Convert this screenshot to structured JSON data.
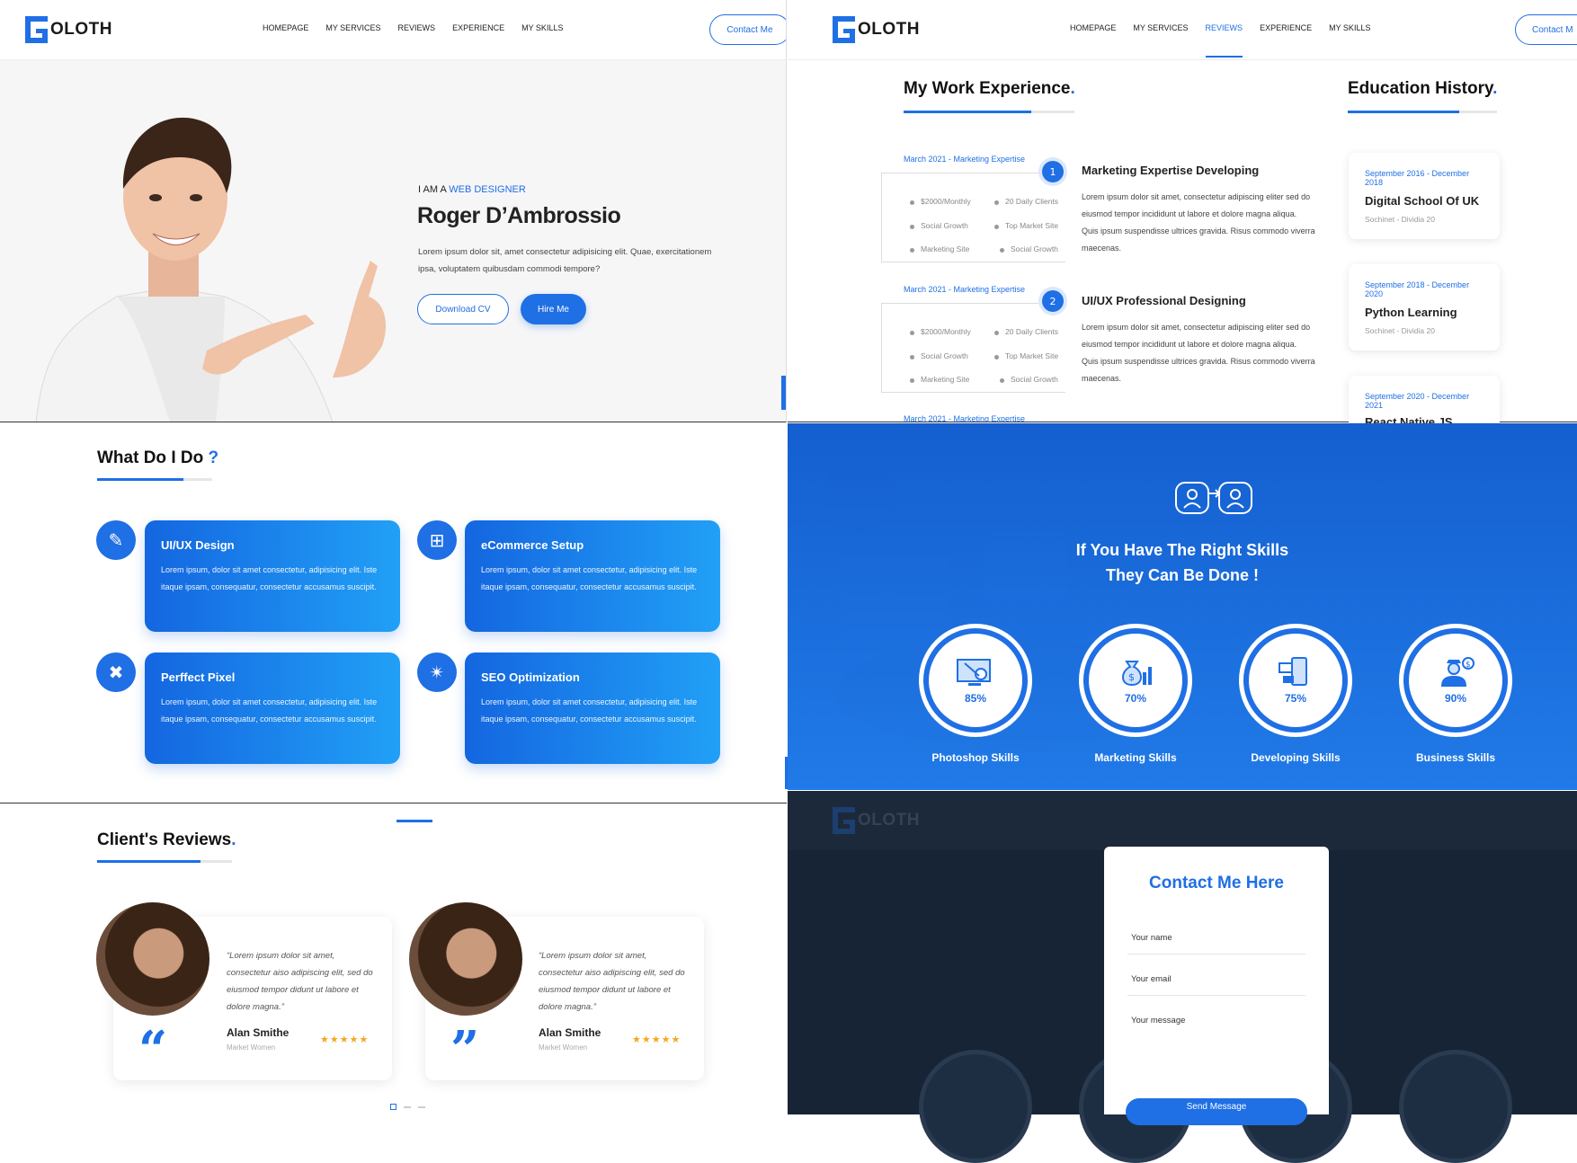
{
  "brand": {
    "logo_letters": "OLOTH",
    "accent": "#1f6fe5"
  },
  "nav": [
    "HOMEPAGE",
    "MY SERVICES",
    "REVIEWS",
    "EXPERIENCE",
    "MY SKILLS"
  ],
  "nav_active_index_panel2": 2,
  "contact_button": "Contact Me",
  "contact_button_cropped": "Contact M",
  "hero": {
    "kicker_prefix": "I AM A ",
    "kicker_highlight": "WEB DESIGNER",
    "name": "Roger D’Ambrossio",
    "text": "Lorem ipsum dolor sit, amet consectetur adipisicing elit. Quae, exercitationem ipsa, voluptatem quibusdam commodi tempore?",
    "download_label": "Download CV",
    "hire_label": "Hire Me"
  },
  "experience": {
    "title": "My Work Experience",
    "items": [
      {
        "date": "March 2021 - Marketing Expertise",
        "num": "1",
        "title": "Marketing Expertise Developing",
        "desc": "Lorem ipsum dolor sit amet, consectetur adipiscing eliter sed do eiusmod tempor incididunt ut labore et dolore magna aliqua. Quis ipsum suspendisse ultrices gravida. Risus commodo viverra maecenas.",
        "bullets": [
          "$2000/Monthly",
          "20 Daily Clients",
          "Social Growth",
          "Top Market Site",
          "Marketing Site",
          "Social Growth"
        ]
      },
      {
        "date": "March 2021 - Marketing Expertise",
        "num": "2",
        "title": "UI/UX Professional Designing",
        "desc": "Lorem ipsum dolor sit amet, consectetur adipiscing eliter sed do eiusmod tempor incididunt ut labore et dolore magna aliqua. Quis ipsum suspendisse ultrices gravida. Risus commodo viverra maecenas.",
        "bullets": [
          "$2000/Monthly",
          "20 Daily Clients",
          "Social Growth",
          "Top Market Site",
          "Marketing Site",
          "Social Growth"
        ]
      },
      {
        "date": "March 2021 - Marketing Expertise"
      }
    ]
  },
  "education": {
    "title": "Education History",
    "items": [
      {
        "date": "September 2016 - December 2018",
        "school": "Digital School Of UK",
        "loc": "Sochinet - Dividia 20"
      },
      {
        "date": "September 2018 - December 2020",
        "school": "Python Learning",
        "loc": "Sochinet - Dividia 20"
      },
      {
        "date": "September 2020 - December 2021",
        "school": "React Native JS Courses"
      }
    ]
  },
  "services": {
    "title": "What Do I Do",
    "title_mark": "?",
    "items": [
      {
        "title": "UI/UX Design",
        "text": "Lorem ipsum, dolor sit amet consectetur, adipisicing elit. Iste itaque ipsam, consequatur, consectetur accusamus suscipit.",
        "icon": "pencil-icon",
        "glyph": "✎"
      },
      {
        "title": "eCommerce Setup",
        "text": "Lorem ipsum, dolor sit amet consectetur, adipisicing elit. Iste itaque ipsam, consequatur, consectetur accusamus suscipit.",
        "icon": "cart-icon",
        "glyph": "⊞"
      },
      {
        "title": "Perffect Pixel",
        "text": "Lorem ipsum, dolor sit amet consectetur, adipisicing elit. Iste itaque ipsam, consequatur, consectetur accusamus suscipit.",
        "icon": "tools-icon",
        "glyph": "✖"
      },
      {
        "title": "SEO Optimization",
        "text": "Lorem ipsum, dolor sit amet consectetur, adipisicing elit. Iste itaque ipsam, consequatur, consectetur accusamus suscipit.",
        "icon": "rocket-icon",
        "glyph": "✴"
      }
    ]
  },
  "skills": {
    "headline_1": "If You Have The Right Skills",
    "headline_2": "They Can Be Done !",
    "items": [
      {
        "label": "Photoshop Skills",
        "pct": "85%",
        "icon": "design-monitor-icon"
      },
      {
        "label": "Marketing Skills",
        "pct": "70%",
        "icon": "money-bag-icon"
      },
      {
        "label": "Developing Skills",
        "pct": "75%",
        "icon": "devices-icon"
      },
      {
        "label": "Business Skills",
        "pct": "90%",
        "icon": "businessman-icon"
      }
    ]
  },
  "reviews": {
    "title": "Client's Reviews",
    "items": [
      {
        "quote": "“Lorem ipsum dolor sit amet, consectetur aiso adipiscing elit, sed do eiusmod tempor didunt ut labore et dolore magna.”",
        "name": "Alan Smithe",
        "role": "Market Women",
        "stars": "★★★★★",
        "qmark": "“"
      },
      {
        "quote": "“Lorem ipsum dolor sit amet, consectetur aiso adipiscing elit, sed do eiusmod tempor didunt ut labore et dolore magna.”",
        "name": "Alan Smithe",
        "role": "Market Women",
        "stars": "★★★★★",
        "qmark": "”"
      }
    ]
  },
  "contact": {
    "title": "Contact Me Here",
    "name_ph": "Your name",
    "email_ph": "Your email",
    "message_ph": "Your message",
    "send_label": "Send Message"
  }
}
